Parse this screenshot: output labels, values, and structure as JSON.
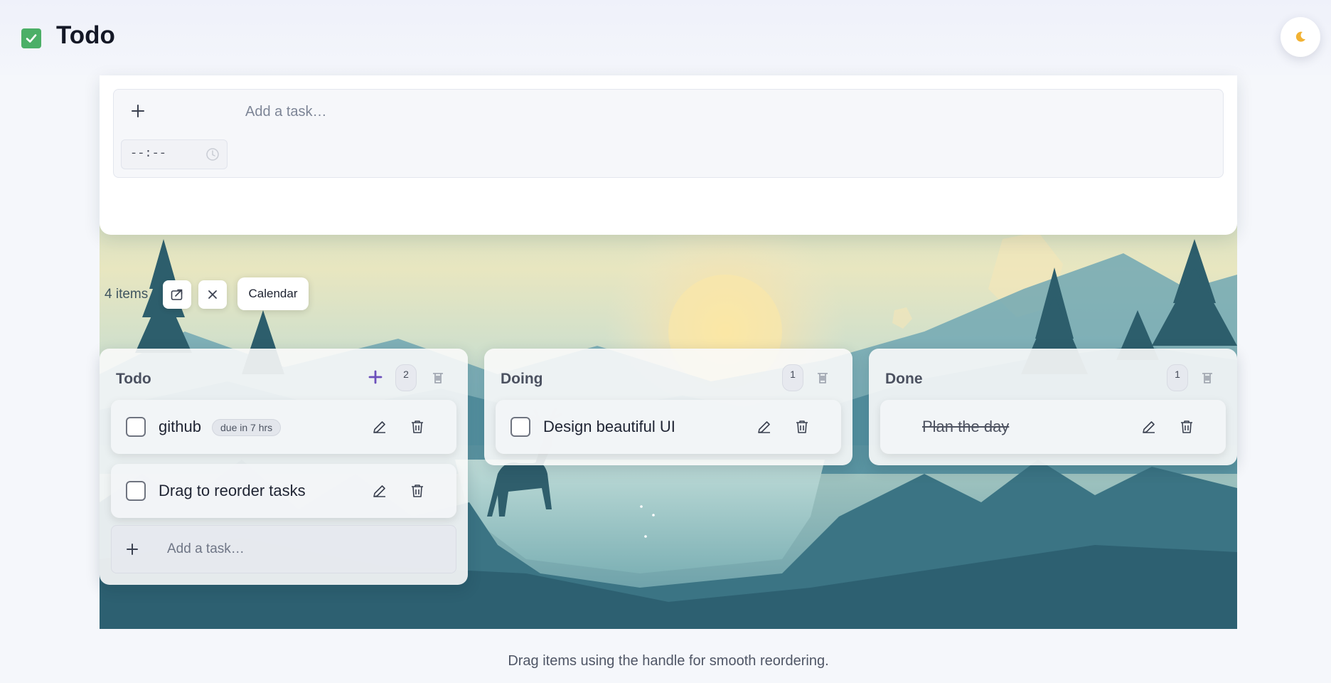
{
  "app": {
    "title": "Todo",
    "theme_toggle_icon": "moon-icon"
  },
  "add_task": {
    "placeholder": "Add a task…",
    "time_placeholder": "--:--",
    "icon": "plus-icon"
  },
  "toolbar": {
    "items_label": "4 items",
    "calendar_label": "Calendar"
  },
  "columns": [
    {
      "title": "Todo",
      "count": "2",
      "add_placeholder": "Add a task…",
      "tasks": [
        {
          "text": "github",
          "due": "due in 7 hrs",
          "done": false
        },
        {
          "text": "Drag to reorder tasks",
          "done": false
        }
      ]
    },
    {
      "title": "Doing",
      "count": "1",
      "tasks": [
        {
          "text": "Design beautiful UI",
          "done": false
        }
      ]
    },
    {
      "title": "Done",
      "count": "1",
      "tasks": [
        {
          "text": "Plan the day",
          "done": true
        }
      ]
    }
  ],
  "footer": {
    "note": "Drag items using the handle for smooth reordering."
  },
  "colors": {
    "accent": "#6b4fbb",
    "logo_green": "#4caf67"
  }
}
